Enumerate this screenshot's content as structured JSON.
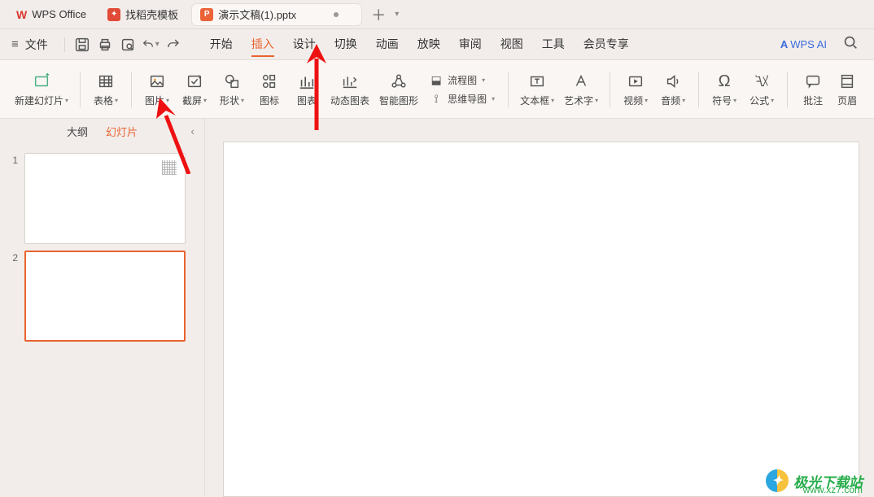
{
  "titlebar": {
    "app_name": "WPS Office",
    "template_tab": "找稻壳模板",
    "doc_tab": "演示文稿(1).pptx"
  },
  "menubar": {
    "file": "文件",
    "tabs": [
      "开始",
      "插入",
      "设计",
      "切换",
      "动画",
      "放映",
      "审阅",
      "视图",
      "工具",
      "会员专享"
    ],
    "active_index": 1,
    "wps_ai": "WPS AI"
  },
  "ribbon": {
    "new_slide": "新建幻灯片",
    "table": "表格",
    "picture": "图片",
    "screenshot": "截屏",
    "shape": "形状",
    "icon": "图标",
    "chart": "图表",
    "dyn_chart": "动态图表",
    "smart_shape": "智能图形",
    "flowchart": "流程图",
    "mindmap": "思维导图",
    "textbox": "文本框",
    "wordart": "艺术字",
    "video": "视频",
    "audio": "音频",
    "symbol": "符号",
    "formula": "公式",
    "comment": "批注",
    "header": "页眉"
  },
  "sidepanel": {
    "outline_tab": "大纲",
    "slides_tab": "幻灯片",
    "slides": [
      "1",
      "2"
    ],
    "selected": 2
  },
  "watermark": {
    "title": "极光下载站",
    "url": "www.xz7.com"
  }
}
